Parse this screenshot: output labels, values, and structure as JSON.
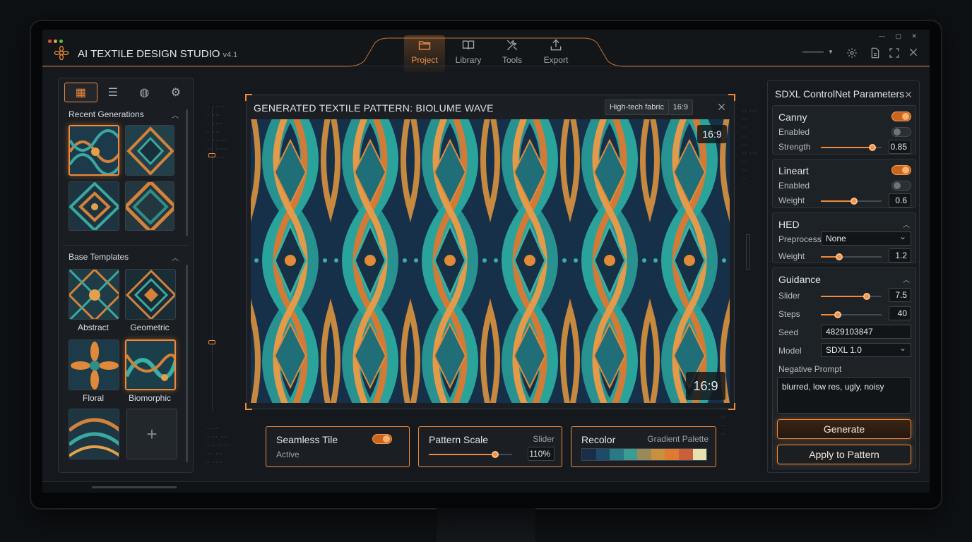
{
  "app": {
    "title": "AI TEXTILE DESIGN STUDIO",
    "version": "v4.1"
  },
  "nav": [
    {
      "label": "Project",
      "icon": "folder-icon",
      "active": true
    },
    {
      "label": "Library",
      "icon": "book-icon",
      "active": false
    },
    {
      "label": "Tools",
      "icon": "tools-icon",
      "active": false
    },
    {
      "label": "Export",
      "icon": "export-icon",
      "active": false
    }
  ],
  "left": {
    "recent_title": "Recent Generations",
    "templates_title": "Base Templates",
    "templates": [
      "Abstract",
      "Geometric",
      "Floral",
      "Biomorphic"
    ]
  },
  "viewer": {
    "title": "GENERATED TEXTILE PATTERN: BIOLUME WAVE",
    "chip_fabric": "High-tech fabric",
    "chip_ratio": "16:9",
    "overlay_ratio_top": "16:9",
    "overlay_ratio_bottom": "16:9"
  },
  "bottom": {
    "seamless": {
      "title": "Seamless Tile",
      "status": "Active",
      "enabled": true
    },
    "scale": {
      "title": "Pattern Scale",
      "hint": "Slider",
      "value": "110%",
      "level": 0.8
    },
    "recolor": {
      "title": "Recolor",
      "hint": "Gradient Palette",
      "palette": [
        "#1a2e4a",
        "#1f4a6a",
        "#2a7a85",
        "#3a9c95",
        "#9a8a5a",
        "#c99040",
        "#e07a30",
        "#c9603a",
        "#e8e0b0"
      ]
    }
  },
  "right": {
    "title": "SDXL ControlNet Parameters",
    "canny": {
      "title": "Canny",
      "enabled_label": "Enabled",
      "strength_label": "Strength",
      "strength": "0.85",
      "level": 0.85
    },
    "lineart": {
      "title": "Lineart",
      "enabled_label": "Enabled",
      "weight_label": "Weight",
      "weight": "0.6",
      "level": 0.55
    },
    "hed": {
      "title": "HED",
      "preprocess_label": "Preprocess",
      "preprocess": "None",
      "weight_label": "Weight",
      "weight": "1.2",
      "level": 0.3
    },
    "guidance": {
      "title": "Guidance",
      "slider_label": "Slider",
      "slider": "7.5",
      "slider_level": 0.75,
      "steps_label": "Steps",
      "steps": "40",
      "steps_level": 0.28,
      "seed_label": "Seed",
      "seed": "4829103847",
      "model_label": "Model",
      "model": "SDXL 1.0",
      "neg_label": "Negative Prompt",
      "neg": "blurred, low res, ugly, noisy"
    },
    "generate": "Generate",
    "apply": "Apply to Pattern"
  },
  "colors": {
    "accent": "#f08a3a",
    "bg": "#15191d"
  }
}
